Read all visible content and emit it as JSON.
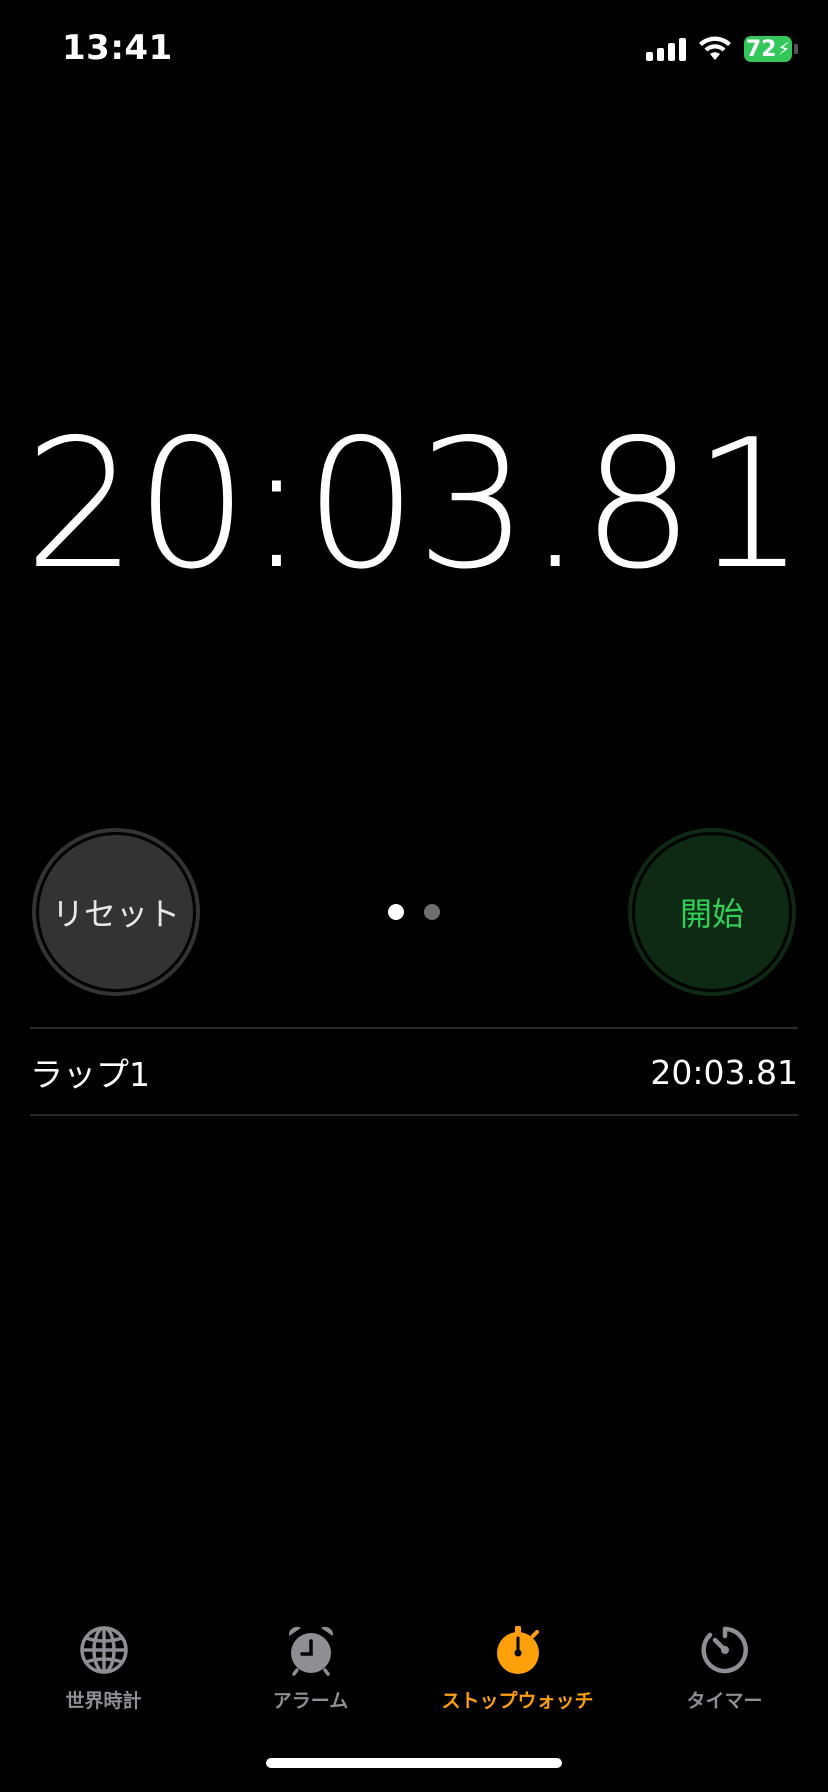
{
  "status_bar": {
    "time": "13:41",
    "battery_level": "72",
    "battery_charging": true
  },
  "stopwatch": {
    "display": "20:03.81"
  },
  "controls": {
    "reset_label": "リセット",
    "start_label": "開始",
    "page_indicator": {
      "count": 2,
      "active_index": 0
    }
  },
  "laps": [
    {
      "label": "ラップ1",
      "time": "20:03.81"
    }
  ],
  "tab_bar": {
    "tabs": [
      {
        "label": "世界時計",
        "icon": "globe-icon",
        "active": false
      },
      {
        "label": "アラーム",
        "icon": "alarm-clock-icon",
        "active": false
      },
      {
        "label": "ストップウォッチ",
        "icon": "stopwatch-icon",
        "active": true
      },
      {
        "label": "タイマー",
        "icon": "timer-icon",
        "active": false
      }
    ]
  },
  "colors": {
    "accent_active_tab": "#ff9f0a",
    "start_text": "#30d158",
    "start_bg": "#0e2a14",
    "reset_bg": "#333333",
    "battery": "#34c759",
    "inactive": "#8e8e93"
  }
}
